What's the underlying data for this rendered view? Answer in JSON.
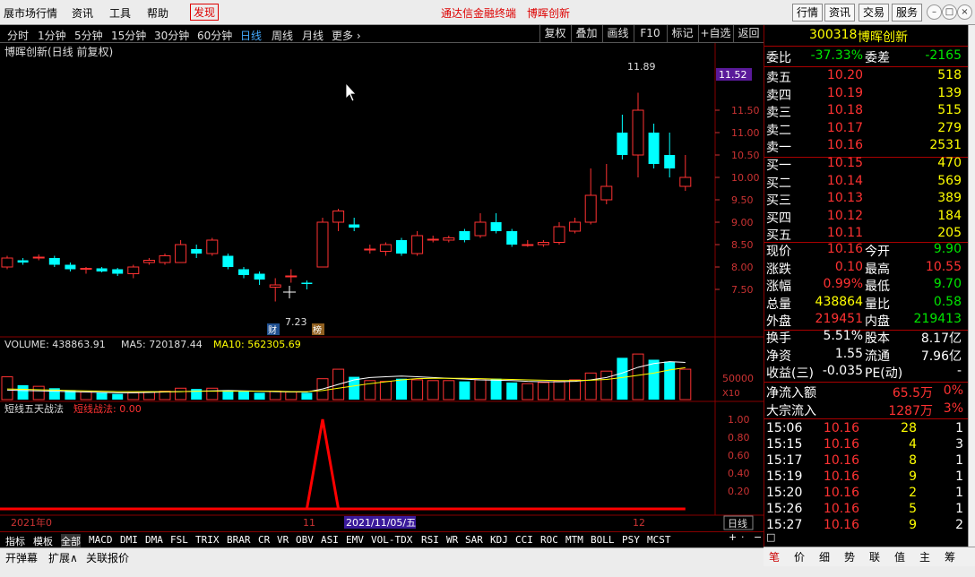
{
  "menubar": {
    "items": [
      "展市场行情",
      "资讯",
      "工具",
      "帮助",
      "发现"
    ],
    "center": [
      "通达信金融终端",
      "博晖创新"
    ],
    "buttons": [
      "行情",
      "资讯",
      "交易",
      "服务"
    ]
  },
  "periods": [
    "分时",
    "1分钟",
    "5分钟",
    "15分钟",
    "30分钟",
    "60分钟",
    "日线",
    "周线",
    "月线",
    "更多 ›"
  ],
  "toolbar": [
    "复权",
    "叠加",
    "画线",
    "F10",
    "标记",
    "+自选",
    "返回"
  ],
  "chart": {
    "stock_title": "博晖创新(日线 前复权)",
    "high_label": "11.89",
    "low_label": "7.23",
    "cur_price_box": "11.52",
    "badge_cai": "财",
    "badge_bang": "榜",
    "price_ticks": [
      "11.50",
      "11.00",
      "10.50",
      "10.00",
      "9.50",
      "9.00",
      "8.50",
      "8.00",
      "7.50"
    ],
    "volume_label": "VOLUME: 438863.91",
    "ma5_label": "MA5: 720187.44",
    "ma10_label": "MA10: 562305.69",
    "vol_tick": "50000",
    "vol_unit": "X10",
    "ind_title": "短线五天战法",
    "ind_label": "短线战法: 0.00",
    "ind_ticks": [
      "1.00",
      "0.80",
      "0.60",
      "0.40",
      "0.20"
    ],
    "date_left": "2021年0",
    "date_mid": "11",
    "date_cursor": "2021/11/05/五",
    "date_right": "12",
    "period_btn": "日线",
    "colors": {
      "up": "#ff3232",
      "down": "#00ffff",
      "ma5": "#ffffff",
      "ma10": "#ffff00",
      "ind": "#ff0000"
    }
  },
  "indicators": [
    "指标",
    "模板",
    "全部",
    "MACD",
    "DMI",
    "DMA",
    "FSL",
    "TRIX",
    "BRAR",
    "CR",
    "VR",
    "OBV",
    "ASI",
    "EMV",
    "VOL-TDX",
    "RSI",
    "WR",
    "SAR",
    "KDJ",
    "CCI",
    "ROC",
    "MTM",
    "BOLL",
    "PSY",
    "MCST"
  ],
  "bottombar": [
    "开弹幕",
    "扩展∧",
    "关联报价"
  ],
  "quote": {
    "code": "300318",
    "name": "博晖创新",
    "weibi_label": "委比",
    "weibi": "-37.33%",
    "weicha_label": "委差",
    "weicha": "-2165",
    "sell": [
      {
        "l": "卖五",
        "p": "10.20",
        "v": "518"
      },
      {
        "l": "卖四",
        "p": "10.19",
        "v": "139"
      },
      {
        "l": "卖三",
        "p": "10.18",
        "v": "515"
      },
      {
        "l": "卖二",
        "p": "10.17",
        "v": "279"
      },
      {
        "l": "卖一",
        "p": "10.16",
        "v": "2531"
      }
    ],
    "buy": [
      {
        "l": "买一",
        "p": "10.15",
        "v": "470"
      },
      {
        "l": "买二",
        "p": "10.14",
        "v": "569"
      },
      {
        "l": "买三",
        "p": "10.13",
        "v": "389"
      },
      {
        "l": "买四",
        "p": "10.12",
        "v": "184"
      },
      {
        "l": "买五",
        "p": "10.11",
        "v": "205"
      }
    ],
    "stats": [
      {
        "a": "现价",
        "av": "10.16",
        "ac": "red",
        "b": "今开",
        "bv": "9.90",
        "bc": "grn"
      },
      {
        "a": "涨跌",
        "av": "0.10",
        "ac": "red",
        "b": "最高",
        "bv": "10.55",
        "bc": "red"
      },
      {
        "a": "涨幅",
        "av": "0.99%",
        "ac": "red",
        "b": "最低",
        "bv": "9.70",
        "bc": "grn"
      },
      {
        "a": "总量",
        "av": "438864",
        "ac": "yel",
        "b": "量比",
        "bv": "0.58",
        "bc": "grn"
      },
      {
        "a": "外盘",
        "av": "219451",
        "ac": "red",
        "b": "内盘",
        "bv": "219413",
        "bc": "grn"
      }
    ],
    "stats2": [
      {
        "a": "换手",
        "av": "5.51%",
        "b": "股本",
        "bv": "8.17亿"
      },
      {
        "a": "净资",
        "av": "1.55",
        "b": "流通",
        "bv": "7.96亿"
      },
      {
        "a": "收益(三)",
        "av": "-0.035",
        "b": "PE(动)",
        "bv": "-"
      }
    ],
    "flow": [
      {
        "l": "净流入额",
        "v": "65.5万",
        "p": "0%"
      },
      {
        "l": "大宗流入",
        "v": "1287万",
        "p": "3%"
      }
    ],
    "ticks": [
      {
        "t": "15:06",
        "p": "10.16",
        "v": "28",
        "n": "1"
      },
      {
        "t": "15:15",
        "p": "10.16",
        "v": "4",
        "n": "3"
      },
      {
        "t": "15:17",
        "p": "10.16",
        "v": "8",
        "n": "1"
      },
      {
        "t": "15:19",
        "p": "10.16",
        "v": "9",
        "n": "1"
      },
      {
        "t": "15:20",
        "p": "10.16",
        "v": "2",
        "n": "1"
      },
      {
        "t": "15:26",
        "p": "10.16",
        "v": "5",
        "n": "1"
      },
      {
        "t": "15:27",
        "p": "10.16",
        "v": "9",
        "n": "2"
      }
    ]
  },
  "rtabs": [
    "笔",
    "价",
    "细",
    "势",
    "联",
    "值",
    "主",
    "筹"
  ],
  "chart_data": {
    "type": "candlestick",
    "ylim": [
      7.0,
      12.0
    ],
    "candles": [
      {
        "o": 8.0,
        "c": 8.2,
        "h": 8.25,
        "l": 7.95
      },
      {
        "o": 8.15,
        "c": 8.1,
        "h": 8.2,
        "l": 8.05
      },
      {
        "o": 8.2,
        "c": 8.22,
        "h": 8.28,
        "l": 8.15
      },
      {
        "o": 8.2,
        "c": 8.05,
        "h": 8.25,
        "l": 8.0
      },
      {
        "o": 8.05,
        "c": 7.95,
        "h": 8.1,
        "l": 7.9
      },
      {
        "o": 7.95,
        "c": 7.97,
        "h": 8.0,
        "l": 7.85
      },
      {
        "o": 7.97,
        "c": 7.9,
        "h": 8.0,
        "l": 7.88
      },
      {
        "o": 7.95,
        "c": 7.85,
        "h": 7.98,
        "l": 7.8
      },
      {
        "o": 7.85,
        "c": 8.0,
        "h": 8.05,
        "l": 7.75
      },
      {
        "o": 8.1,
        "c": 8.15,
        "h": 8.2,
        "l": 8.05
      },
      {
        "o": 8.1,
        "c": 8.25,
        "h": 8.3,
        "l": 8.05
      },
      {
        "o": 8.1,
        "c": 8.5,
        "h": 8.6,
        "l": 8.1
      },
      {
        "o": 8.4,
        "c": 8.3,
        "h": 8.5,
        "l": 8.2
      },
      {
        "o": 8.3,
        "c": 8.6,
        "h": 8.65,
        "l": 8.25
      },
      {
        "o": 8.25,
        "c": 8.0,
        "h": 8.3,
        "l": 7.95
      },
      {
        "o": 7.95,
        "c": 7.82,
        "h": 8.0,
        "l": 7.75
      },
      {
        "o": 7.85,
        "c": 7.72,
        "h": 7.9,
        "l": 7.6
      },
      {
        "o": 7.55,
        "c": 7.6,
        "h": 7.75,
        "l": 7.23
      },
      {
        "o": 7.8,
        "c": 7.8,
        "h": 7.95,
        "l": 7.65
      },
      {
        "o": 7.65,
        "c": 7.62,
        "h": 7.7,
        "l": 7.5
      },
      {
        "o": 8.0,
        "c": 9.0,
        "h": 9.1,
        "l": 8.0
      },
      {
        "o": 9.0,
        "c": 9.25,
        "h": 9.3,
        "l": 8.8
      },
      {
        "o": 8.95,
        "c": 8.88,
        "h": 9.1,
        "l": 8.8
      },
      {
        "o": 8.4,
        "c": 8.4,
        "h": 8.5,
        "l": 8.3
      },
      {
        "o": 8.35,
        "c": 8.5,
        "h": 8.55,
        "l": 8.25
      },
      {
        "o": 8.6,
        "c": 8.3,
        "h": 8.65,
        "l": 8.25
      },
      {
        "o": 8.3,
        "c": 8.7,
        "h": 8.8,
        "l": 8.25
      },
      {
        "o": 8.6,
        "c": 8.62,
        "h": 8.7,
        "l": 8.55
      },
      {
        "o": 8.6,
        "c": 8.65,
        "h": 8.7,
        "l": 8.55
      },
      {
        "o": 8.8,
        "c": 8.6,
        "h": 8.85,
        "l": 8.55
      },
      {
        "o": 8.7,
        "c": 9.0,
        "h": 9.2,
        "l": 8.65
      },
      {
        "o": 9.0,
        "c": 8.8,
        "h": 9.2,
        "l": 8.75
      },
      {
        "o": 8.8,
        "c": 8.5,
        "h": 8.85,
        "l": 8.45
      },
      {
        "o": 8.48,
        "c": 8.5,
        "h": 8.6,
        "l": 8.45
      },
      {
        "o": 8.5,
        "c": 8.55,
        "h": 8.6,
        "l": 8.45
      },
      {
        "o": 8.55,
        "c": 8.9,
        "h": 9.0,
        "l": 8.5
      },
      {
        "o": 8.8,
        "c": 9.0,
        "h": 9.1,
        "l": 8.75
      },
      {
        "o": 9.0,
        "c": 9.6,
        "h": 10.2,
        "l": 8.95
      },
      {
        "o": 9.5,
        "c": 9.8,
        "h": 10.3,
        "l": 9.4
      },
      {
        "o": 11.0,
        "c": 10.5,
        "h": 11.4,
        "l": 10.4
      },
      {
        "o": 10.5,
        "c": 11.5,
        "h": 11.89,
        "l": 10.0
      },
      {
        "o": 11.0,
        "c": 10.3,
        "h": 11.2,
        "l": 10.2
      },
      {
        "o": 10.5,
        "c": 10.2,
        "h": 11.0,
        "l": 10.0
      },
      {
        "o": 9.8,
        "c": 10.0,
        "h": 10.5,
        "l": 9.7
      }
    ],
    "volume": [
      60,
      38,
      35,
      30,
      25,
      20,
      18,
      15,
      18,
      20,
      22,
      30,
      28,
      30,
      25,
      22,
      18,
      22,
      20,
      18,
      55,
      80,
      60,
      50,
      48,
      55,
      52,
      50,
      50,
      48,
      52,
      55,
      45,
      42,
      45,
      48,
      52,
      70,
      75,
      110,
      120,
      105,
      100,
      80
    ],
    "ma5": [
      25,
      24,
      23,
      22,
      21,
      20,
      19,
      18,
      18,
      19,
      20,
      21,
      22,
      23,
      24,
      23,
      22,
      21,
      20,
      20,
      28,
      40,
      52,
      58,
      60,
      62,
      60,
      58,
      56,
      54,
      52,
      51,
      50,
      48,
      47,
      47,
      48,
      52,
      58,
      70,
      85,
      95,
      100,
      98
    ],
    "ma10": [
      28,
      27,
      26,
      25,
      24,
      23,
      22,
      21,
      21,
      21,
      21,
      21,
      22,
      22,
      22,
      22,
      22,
      22,
      21,
      21,
      24,
      30,
      36,
      42,
      47,
      52,
      55,
      56,
      56,
      56,
      55,
      54,
      53,
      52,
      51,
      50,
      50,
      51,
      53,
      58,
      64,
      70,
      78,
      84
    ],
    "indicator": [
      0,
      0,
      0,
      0,
      0,
      0,
      0,
      0,
      0,
      0,
      0,
      0,
      0,
      0,
      0,
      0,
      0,
      0,
      0,
      0,
      1,
      0,
      0,
      0,
      0,
      0,
      0,
      0,
      0,
      0,
      0,
      0,
      0,
      0,
      0,
      0,
      0,
      0,
      0,
      0,
      0,
      0,
      0,
      0
    ]
  }
}
